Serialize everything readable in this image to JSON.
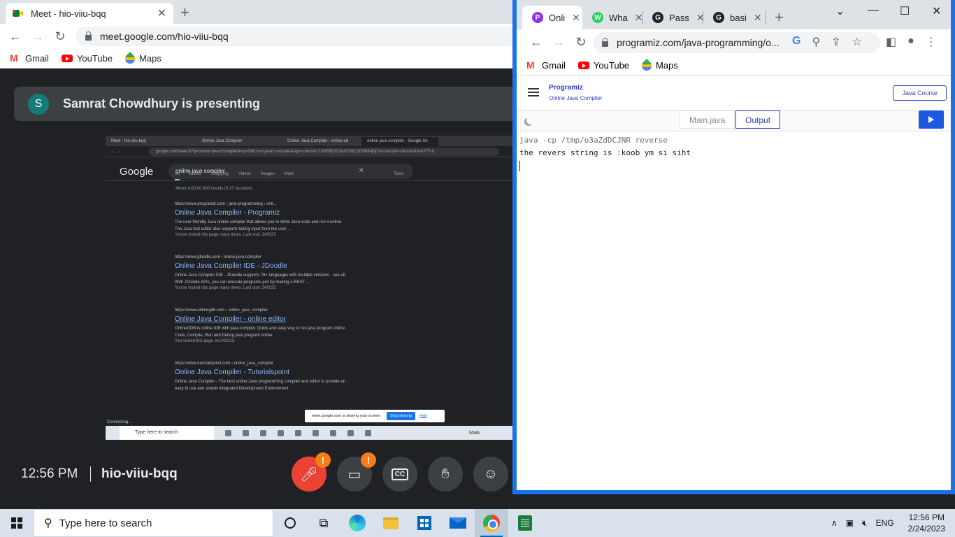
{
  "left_window": {
    "tab_title": "Meet - hio-viiu-bqq",
    "url": "meet.google.com/hio-viiu-bqq",
    "bookmarks": [
      "Gmail",
      "YouTube",
      "Maps"
    ],
    "presenting_initial": "S",
    "presenting_text": "Samrat Chowdhury is presenting",
    "shared_screen": {
      "tabs": [
        "Meet - hio-viiu-bqq",
        "Online Java Compiler",
        "Online Java Compiler - online ed",
        "online java compiler - Google Se"
      ],
      "address": "google.com/search?q=online+java+compiler&oq=ONLine+java+compiler&aqs=chrome.0.69i59j0i131i433i512j0i3884j0j7&sourceid=chrome&ie=UTF-8",
      "google_logo": "Google",
      "search_query": "online java compiler",
      "search_tabs": [
        "All",
        "Books",
        "Shopping",
        "Videos",
        "Images",
        "More"
      ],
      "tools_label": "Tools",
      "about": "About 4,63,00,000 results (0.27 seconds)",
      "results": [
        {
          "url": "https://www.programiz.com › java-programming › onli...",
          "title": "Online Java Compiler - Programiz",
          "desc1": "The user friendly Java online compiler that allows you to Write Java code and run it online.",
          "desc2": "The Java text editor also supports taking input from the user ...",
          "visited": "You've visited this page many times. Last visit: 24/2/23"
        },
        {
          "url": "https://www.jdoodle.com › online-java-compiler",
          "title": "Online Java Compiler IDE - JDoodle",
          "desc1": "Online Java Compiler IDE - JDoodle supports 76+ languages with multiple versions - see all.",
          "desc2": "With JDoodle APIs, you can execute programs just by making a REST ...",
          "visited": "You've visited this page many times. Last visit: 24/2/23"
        },
        {
          "url": "https://www.onlinegdb.com › online_java_compiler",
          "title": "Online Java Compiler - online editor",
          "desc1": "OnlineGDB is online IDE with java compiler. Quick and easy way to run java program online.",
          "desc2": "Code, Compile, Run and Debug java program online.",
          "visited": "You visited this page on 24/2/23."
        },
        {
          "url": "https://www.tutorialspoint.com › online_java_compiler",
          "title": "Online Java Compiler - Tutorialspoint",
          "desc1": "Online Java Compiler - The best online Java programming compiler and editor to provide an",
          "desc2": "easy to use and simple Integrated Development Environment",
          "visited": ""
        }
      ],
      "sharing_banner": "meet.google.com is sharing your screen.",
      "stop_sharing": "Stop sharing",
      "hide": "Hide",
      "status": "Connecting...",
      "taskbar_search": "Type here to search",
      "taskbar_right": "Mark"
    },
    "time": "12:56 PM",
    "meeting_code": "hio-viiu-bqq",
    "cc_label": "CC",
    "warn": "!"
  },
  "right_window": {
    "tabs": [
      {
        "label": "Onli",
        "favicon": "P",
        "color": "#8c35ee"
      },
      {
        "label": "Wha",
        "favicon": "W",
        "color": "#25d366"
      },
      {
        "label": "Pass",
        "favicon": "G",
        "color": "#1f2328"
      },
      {
        "label": "basi",
        "favicon": "G",
        "color": "#1f2328"
      }
    ],
    "url": "programiz.com/java-programming/o...",
    "bookmarks": [
      "Gmail",
      "YouTube",
      "Maps"
    ],
    "logo": "Programiz",
    "subtitle": "Online Java Compiler",
    "java_course": "Java Course",
    "file_tabs": [
      "Main.java",
      "Output"
    ],
    "output_cmd": "java -cp /tmp/o3aZdDCJNR reverse",
    "output_text": "the revers string is :koob ym si siht"
  },
  "taskbar": {
    "search_placeholder": "Type here to search",
    "language": "ENG",
    "time": "12:56 PM",
    "date": "2/24/2023"
  }
}
